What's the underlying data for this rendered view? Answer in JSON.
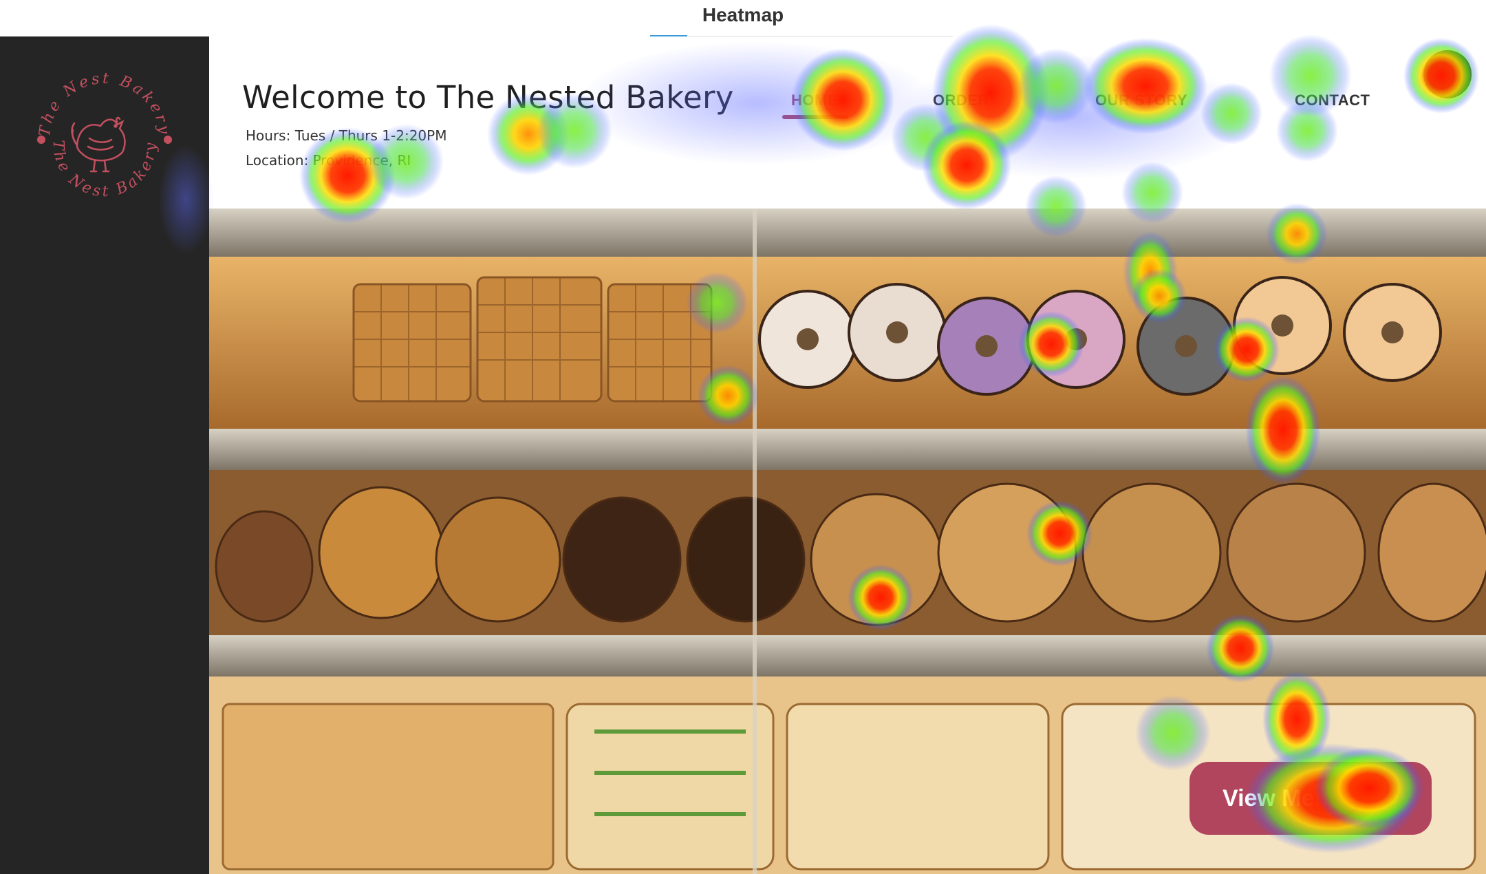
{
  "panel": {
    "title": "Heatmap"
  },
  "brand": {
    "logo_text": "The Nest Bakery"
  },
  "site": {
    "welcome": "Welcome to The Nested Bakery",
    "hours": "Hours: Tues / Thurs 1-2:20PM",
    "location": "Location: Providence, RI",
    "nav": {
      "home": "HOME",
      "order": "ORDER",
      "our_story": "OUR STORY",
      "contact": "CONTACT"
    },
    "cta": "View Menu"
  },
  "colors": {
    "sidebar": "#252525",
    "accent": "#b0455d",
    "tab_active": "#3c9bd6"
  }
}
